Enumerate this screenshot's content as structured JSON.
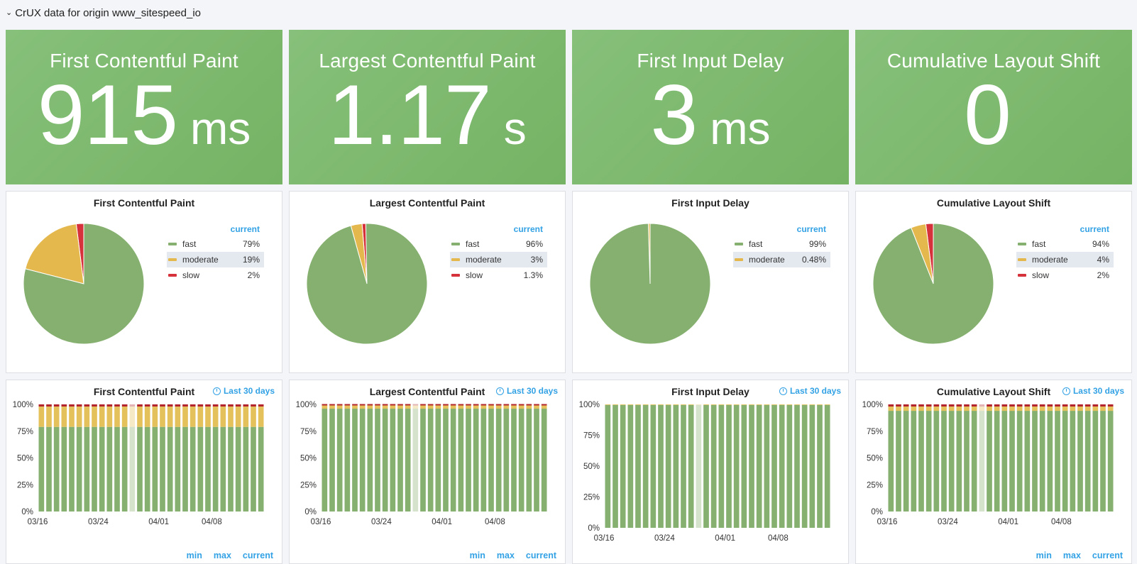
{
  "row": {
    "chevron": "⌄",
    "title": "CrUX data for origin www_sitespeed_io"
  },
  "colors": {
    "fast": "#7eb26d",
    "moderate": "#eab839",
    "slow": "#e02f44",
    "accent": "#33a2e5"
  },
  "stats": [
    {
      "title": "First Contentful Paint",
      "value": "915",
      "unit": "ms"
    },
    {
      "title": "Largest Contentful Paint",
      "value": "1.17",
      "unit": "s"
    },
    {
      "title": "First Input Delay",
      "value": "3",
      "unit": "ms"
    },
    {
      "title": "Cumulative Layout Shift",
      "value": "0",
      "unit": ""
    }
  ],
  "pies": [
    {
      "title": "First Contentful Paint",
      "legend_header": "current",
      "items": [
        {
          "label": "fast",
          "value": "79%",
          "pct": 79
        },
        {
          "label": "moderate",
          "value": "19%",
          "pct": 19
        },
        {
          "label": "slow",
          "value": "2%",
          "pct": 2
        }
      ]
    },
    {
      "title": "Largest Contentful Paint",
      "legend_header": "current",
      "items": [
        {
          "label": "fast",
          "value": "96%",
          "pct": 96
        },
        {
          "label": "moderate",
          "value": "3%",
          "pct": 3
        },
        {
          "label": "slow",
          "value": "1.3%",
          "pct": 1.3
        }
      ]
    },
    {
      "title": "First Input Delay",
      "legend_header": "current",
      "items": [
        {
          "label": "fast",
          "value": "99%",
          "pct": 99.52
        },
        {
          "label": "moderate",
          "value": "0.48%",
          "pct": 0.48
        }
      ]
    },
    {
      "title": "Cumulative Layout Shift",
      "legend_header": "current",
      "items": [
        {
          "label": "fast",
          "value": "94%",
          "pct": 94
        },
        {
          "label": "moderate",
          "value": "4%",
          "pct": 4
        },
        {
          "label": "slow",
          "value": "2%",
          "pct": 2
        }
      ]
    }
  ],
  "bar_panels": [
    {
      "title": "First Contentful Paint",
      "range": "Last 30 days",
      "foot": [
        "min",
        "max",
        "current"
      ]
    },
    {
      "title": "Largest Contentful Paint",
      "range": "Last 30 days",
      "foot": [
        "min",
        "max",
        "current"
      ]
    },
    {
      "title": "First Input Delay",
      "range": "Last 30 days",
      "foot": [
        "min",
        "max",
        "current"
      ]
    },
    {
      "title": "Cumulative Layout Shift",
      "range": "Last 30 days",
      "foot": [
        "min",
        "max",
        "current"
      ]
    }
  ],
  "chart_data": [
    {
      "type": "bar",
      "title": "First Contentful Paint",
      "stacked": true,
      "x_ticks": [
        "03/16",
        "03/24",
        "04/01",
        "04/08"
      ],
      "y_ticks": [
        "100%",
        "75%",
        "50%",
        "25%",
        "0%"
      ],
      "ylim": [
        0,
        100
      ],
      "bars": 30,
      "highlight_bar": 12,
      "series": [
        {
          "name": "fast",
          "value": 79
        },
        {
          "name": "moderate",
          "value": 19
        },
        {
          "name": "slow",
          "value": 2
        }
      ]
    },
    {
      "type": "bar",
      "title": "Largest Contentful Paint",
      "stacked": true,
      "x_ticks": [
        "03/16",
        "03/24",
        "04/01",
        "04/08"
      ],
      "y_ticks": [
        "100%",
        "75%",
        "50%",
        "25%",
        "0%"
      ],
      "ylim": [
        0,
        100
      ],
      "bars": 30,
      "highlight_bar": 12,
      "series": [
        {
          "name": "fast",
          "value": 96
        },
        {
          "name": "moderate",
          "value": 3
        },
        {
          "name": "slow",
          "value": 1.3
        }
      ]
    },
    {
      "type": "bar",
      "title": "First Input Delay",
      "stacked": true,
      "x_ticks": [
        "03/16",
        "03/24",
        "04/01",
        "04/08"
      ],
      "y_ticks": [
        "100%",
        "75%",
        "50%",
        "25%",
        "0%"
      ],
      "ylim": [
        0,
        100
      ],
      "bars": 30,
      "highlight_bar": 12,
      "series": [
        {
          "name": "fast",
          "value": 99.52
        },
        {
          "name": "moderate",
          "value": 0.48
        },
        {
          "name": "slow",
          "value": 0
        }
      ]
    },
    {
      "type": "bar",
      "title": "Cumulative Layout Shift",
      "stacked": true,
      "x_ticks": [
        "03/16",
        "03/24",
        "04/01",
        "04/08"
      ],
      "y_ticks": [
        "100%",
        "75%",
        "50%",
        "25%",
        "0%"
      ],
      "ylim": [
        0,
        100
      ],
      "bars": 30,
      "highlight_bar": 12,
      "series": [
        {
          "name": "fast",
          "value": 94
        },
        {
          "name": "moderate",
          "value": 4
        },
        {
          "name": "slow",
          "value": 2
        }
      ]
    }
  ]
}
